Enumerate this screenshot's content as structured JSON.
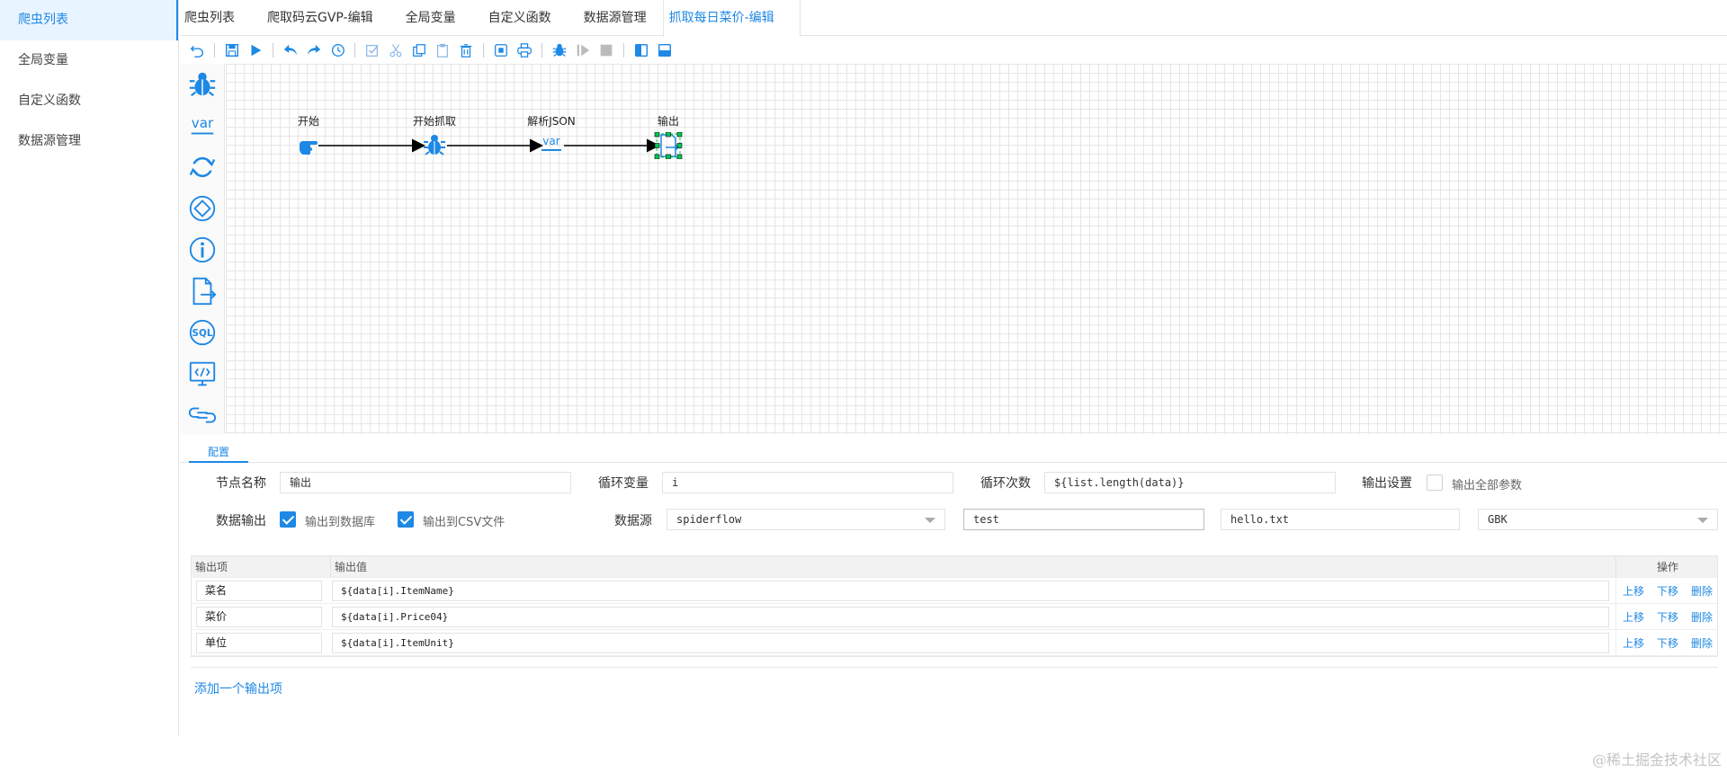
{
  "sidebar": {
    "items": [
      {
        "label": "爬虫列表"
      },
      {
        "label": "全局变量"
      },
      {
        "label": "自定义函数"
      },
      {
        "label": "数据源管理"
      }
    ]
  },
  "tabs": [
    {
      "label": "爬虫列表"
    },
    {
      "label": "爬取码云GVP-编辑"
    },
    {
      "label": "全局变量"
    },
    {
      "label": "自定义函数"
    },
    {
      "label": "数据源管理"
    },
    {
      "label": "抓取每日菜价-编辑"
    }
  ],
  "flow": {
    "nodes": [
      {
        "label": "开始"
      },
      {
        "label": "开始抓取"
      },
      {
        "label": "解析JSON"
      },
      {
        "label": "输出"
      }
    ]
  },
  "config": {
    "tab_label": "配置",
    "node_name_label": "节点名称",
    "node_name_value": "输出",
    "loop_var_label": "循环变量",
    "loop_var_value": "i",
    "loop_count_label": "循环次数",
    "loop_count_value": "${list.length(data)}",
    "output_settings_label": "输出设置",
    "output_all_label": "输出全部参数",
    "data_output_label": "数据输出",
    "to_db_label": "输出到数据库",
    "to_csv_label": "输出到CSV文件",
    "datasource_label": "数据源",
    "datasource_value": "spiderflow",
    "table_value": "test",
    "csv_file_value": "hello.txt",
    "encoding_value": "GBK"
  },
  "output_table": {
    "headers": {
      "item": "输出项",
      "value": "输出值",
      "ops": "操作"
    },
    "rows": [
      {
        "item": "菜名",
        "value": "${data[i].ItemName}"
      },
      {
        "item": "菜价",
        "value": "${data[i].Price04}"
      },
      {
        "item": "单位",
        "value": "${data[i].ItemUnit}"
      }
    ],
    "ops": {
      "up": "上移",
      "down": "下移",
      "delete": "删除"
    },
    "add_label": "添加一个输出项"
  },
  "watermark": "@稀土掘金技术社区",
  "colors": {
    "accent": "#1e88e5",
    "palette_icon": "#1e88e5"
  }
}
